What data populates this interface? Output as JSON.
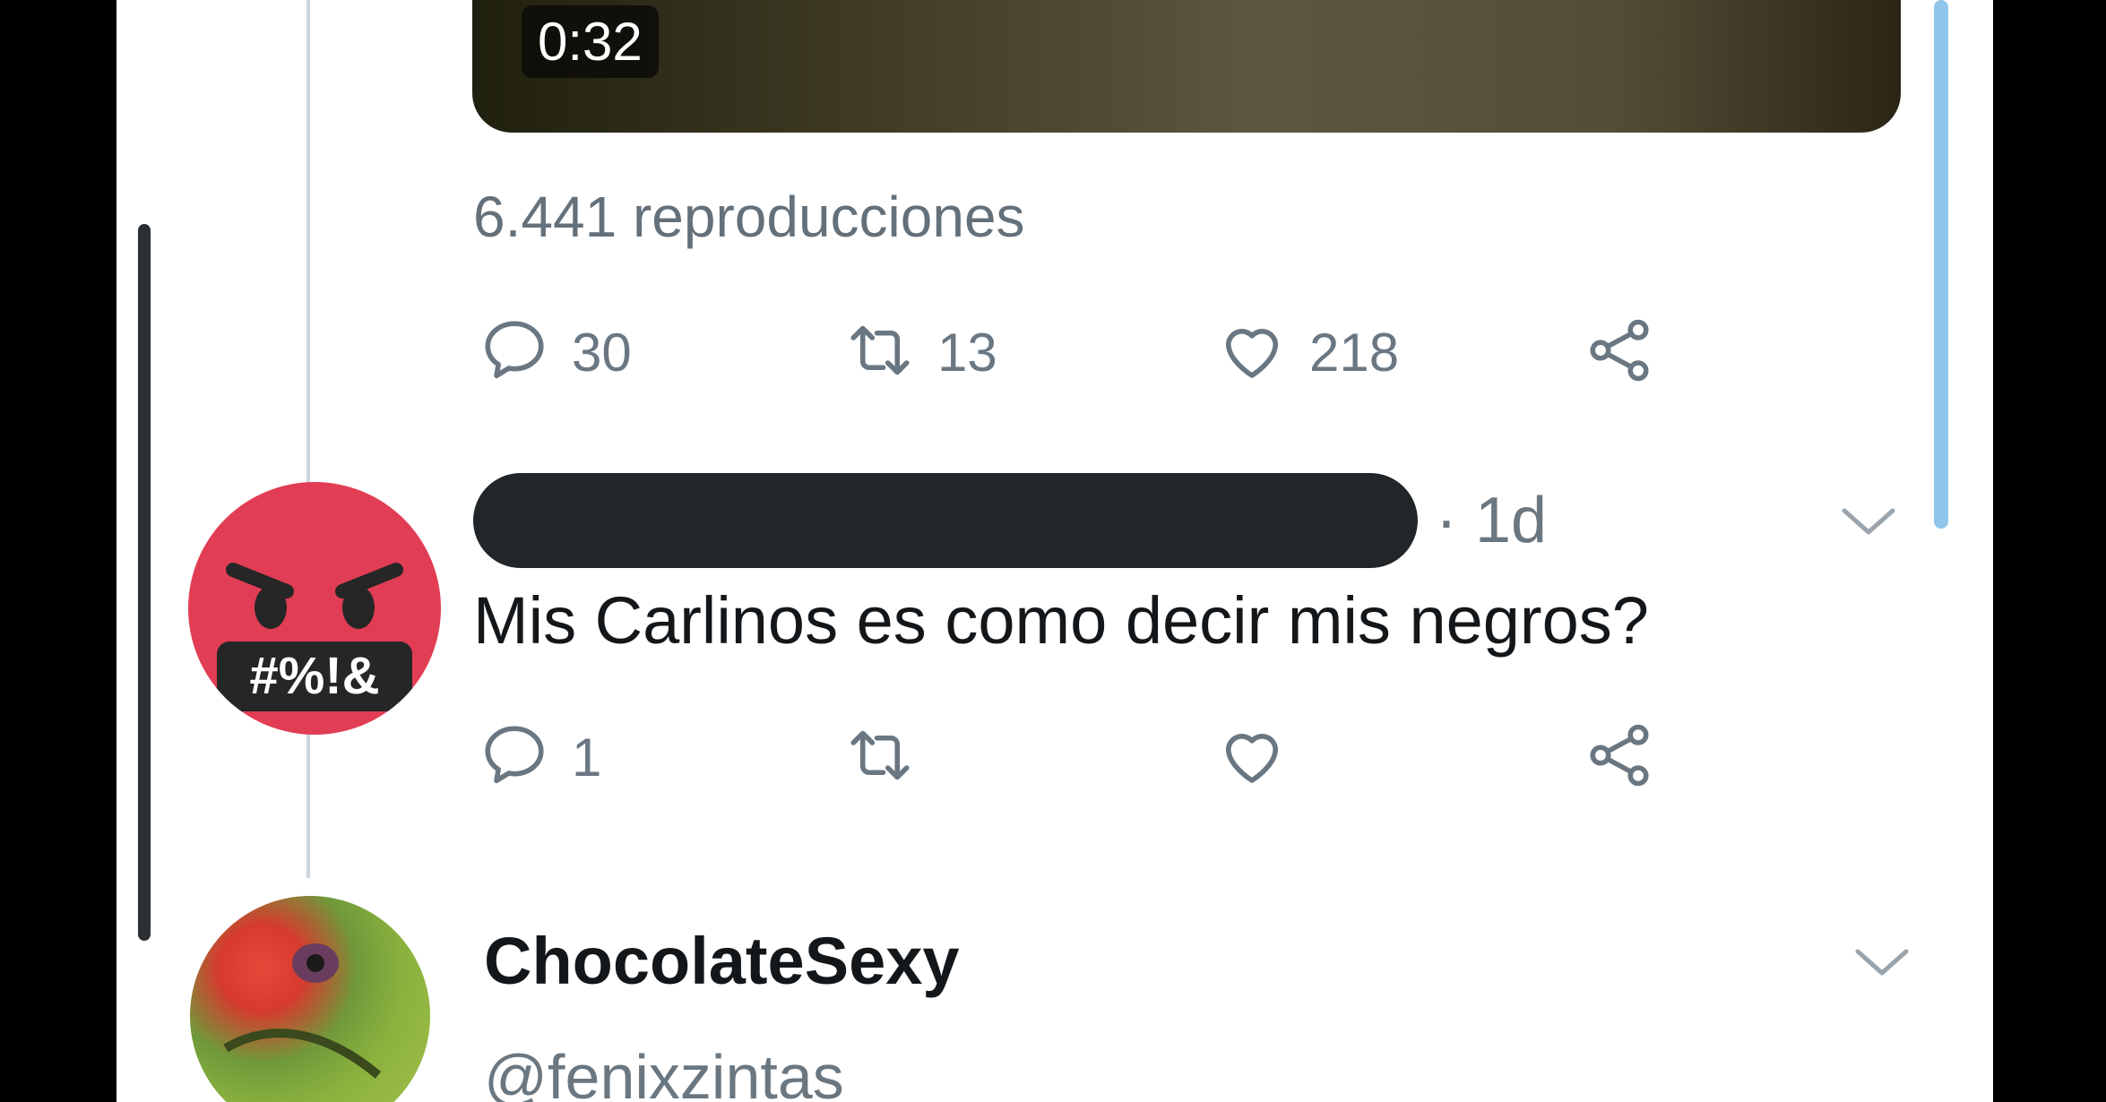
{
  "video": {
    "duration": "0:32"
  },
  "main_tweet": {
    "views": "6.441 reproducciones",
    "reply_count": "30",
    "retweet_count": "13",
    "like_count": "218"
  },
  "reply_tweet": {
    "timestamp": "· 1d",
    "text": "Mis Carlinos es como decir mis negros?",
    "avatar_text": "#%!&",
    "reply_count": "1"
  },
  "next_tweet": {
    "display_name": "ChocolateSexy",
    "handle": "@fenixzintas"
  },
  "colors": {
    "icon": "#6a7782",
    "text": "#14171a",
    "secondary": "#6b7780",
    "avatar_red": "#e13d55",
    "accent": "#8fc6ea"
  },
  "icons": [
    "reply-icon",
    "retweet-icon",
    "like-icon",
    "share-icon",
    "chevron-down-icon"
  ]
}
